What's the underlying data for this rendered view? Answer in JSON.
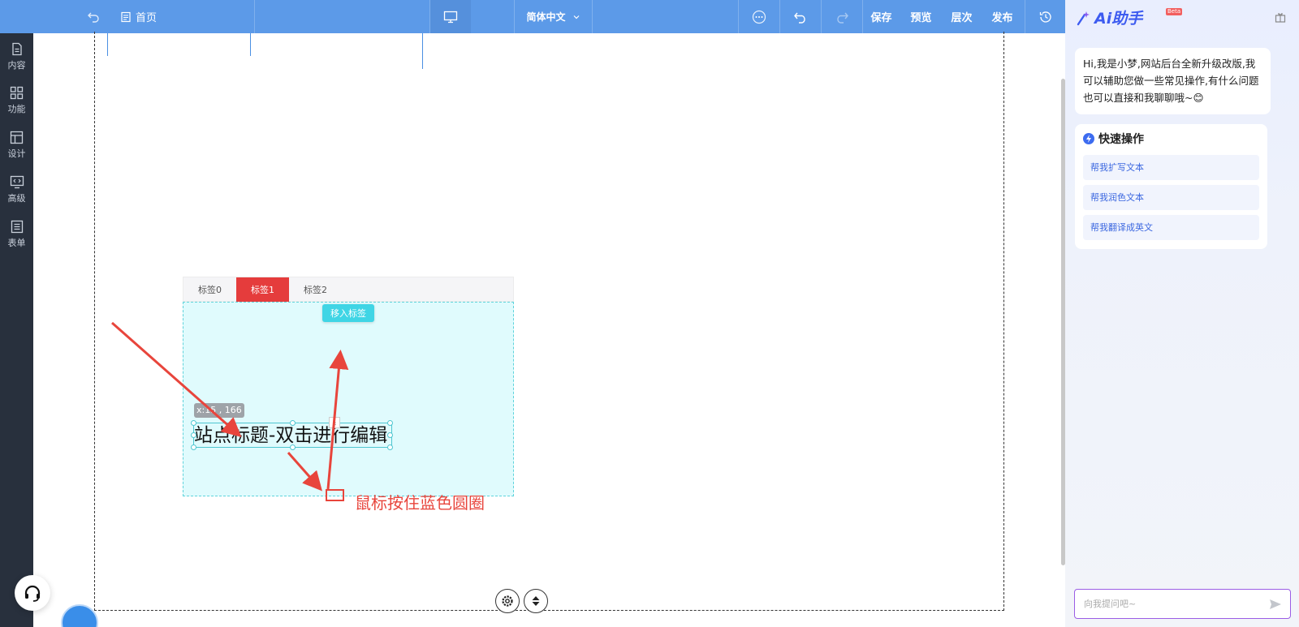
{
  "toolbar": {
    "home_label": "首页",
    "language": "简体中文",
    "save_label": "保存",
    "preview_label": "预览",
    "layers_label": "层次",
    "publish_label": "发布"
  },
  "sidebar": {
    "items": [
      {
        "label": "内容",
        "icon": "document-icon"
      },
      {
        "label": "功能",
        "icon": "grid-icon"
      },
      {
        "label": "设计",
        "icon": "layout-icon"
      },
      {
        "label": "高级",
        "icon": "code-icon"
      },
      {
        "label": "表单",
        "icon": "form-icon"
      }
    ]
  },
  "canvas": {
    "tabs": [
      {
        "label": "标签0",
        "active": false
      },
      {
        "label": "标签1",
        "active": true
      },
      {
        "label": "标签2",
        "active": false
      }
    ],
    "move_in_label": "移入标签",
    "coordinates_label": "x:15 , 166",
    "title_text": "站点标题-双击进行编辑",
    "annotation": "鼠标按住蓝色圆圈",
    "accent_color": "#e53c3c",
    "annotation_color": "#e8453c"
  },
  "ai_panel": {
    "brand": "Ai助手",
    "beta_badge": "Beta",
    "greeting": "Hi,我是小梦,网站后台全新升级改版,我可以辅助您做一些常见操作,有什么问题也可以直接和我聊聊哦~😊",
    "quick_title": "快速操作",
    "quick_actions": [
      "帮我扩写文本",
      "帮我润色文本",
      "帮我翻译成英文"
    ],
    "input_placeholder": "向我提问吧~"
  }
}
